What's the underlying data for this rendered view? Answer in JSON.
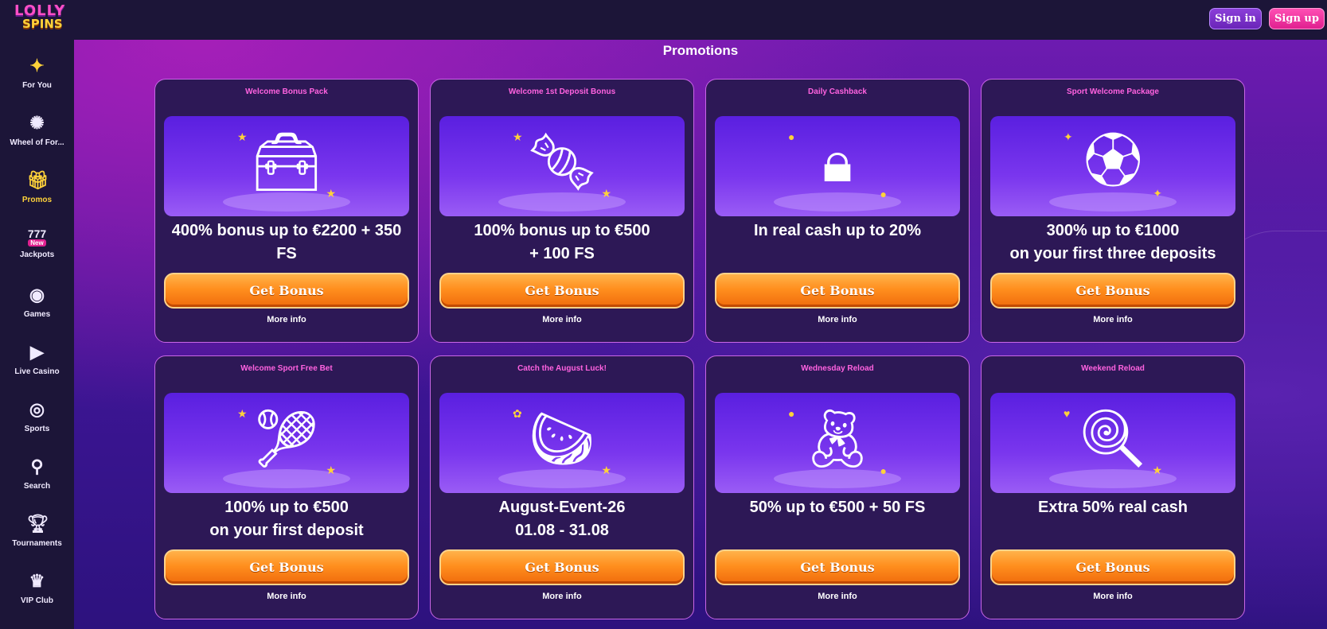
{
  "brand": {
    "line1": "LOLLY",
    "line2": "SPINS"
  },
  "header": {
    "sign_in": "Sign in",
    "sign_up": "Sign up"
  },
  "sidebar": {
    "items": [
      {
        "label": "For You",
        "icon": "sparkles-icon"
      },
      {
        "label": "Wheel of For...",
        "icon": "wheel-icon"
      },
      {
        "label": "Promos",
        "icon": "gift-icon"
      },
      {
        "label": "Jackpots",
        "icon": "slot-machine-icon",
        "badge": "New"
      },
      {
        "label": "Games",
        "icon": "gamepad-icon"
      },
      {
        "label": "Live Casino",
        "icon": "play-icon"
      },
      {
        "label": "Sports",
        "icon": "basketball-icon"
      },
      {
        "label": "Search",
        "icon": "search-icon"
      },
      {
        "label": "Tournaments",
        "icon": "trophy-icon"
      },
      {
        "label": "VIP Club",
        "icon": "crown-icon"
      }
    ]
  },
  "main": {
    "title": "Promotions",
    "cards": [
      {
        "title": "Welcome Bonus Pack",
        "text": "400% bonus up to €2200 + 350 FS",
        "button": "Get Bonus",
        "more": "More info",
        "art": "treasure-chest"
      },
      {
        "title": "Welcome 1st Deposit Bonus",
        "text": "100% bonus up to €500\n+ 100 FS",
        "button": "Get Bonus",
        "more": "More info",
        "art": "candy"
      },
      {
        "title": "Daily Cashback",
        "text": "In real cash up to 20%",
        "button": "Get Bonus",
        "more": "More info",
        "art": "safe"
      },
      {
        "title": "Sport Welcome Package",
        "text": "300% up to €1000\non your first three deposits",
        "button": "Get Bonus",
        "more": "More info",
        "art": "soccer-ball"
      },
      {
        "title": "Welcome Sport Free Bet",
        "text": "100% up to €500\non your first deposit",
        "button": "Get Bonus",
        "more": "More info",
        "art": "tennis-bucket"
      },
      {
        "title": "Catch the August Luck!",
        "text": "August-Event-26\n01.08 - 31.08",
        "button": "Get Bonus",
        "more": "More info",
        "art": "watermelon"
      },
      {
        "title": "Wednesday Reload",
        "text": "50% up to €500 + 50 FS",
        "button": "Get Bonus",
        "more": "More info",
        "art": "gummy-bear"
      },
      {
        "title": "Weekend Reload",
        "text": "Extra 50% real cash",
        "button": "Get Bonus",
        "more": "More info",
        "art": "lollipop"
      }
    ]
  },
  "colors": {
    "accent_pink": "#ff62e0",
    "button_orange": "#ff8f1e",
    "card_bg": "#2d1856",
    "promo_gold": "#ffd23a"
  }
}
